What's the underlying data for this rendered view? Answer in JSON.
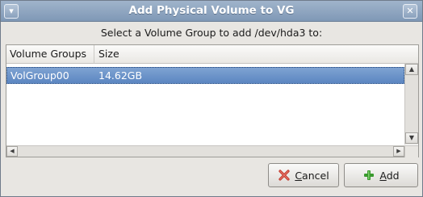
{
  "window": {
    "title": "Add Physical Volume to VG"
  },
  "prompt": "Select a Volume Group to add /dev/hda3 to:",
  "table": {
    "columns": [
      "Volume Groups",
      "Size"
    ],
    "rows": [
      {
        "volume_group": "VolGroup00",
        "size": "14.62GB",
        "selected": true
      }
    ]
  },
  "buttons": {
    "cancel": {
      "mnemonic": "C",
      "rest": "ancel",
      "icon": "cancel-x-icon"
    },
    "add": {
      "mnemonic": "A",
      "rest": "dd",
      "icon": "plus-icon"
    }
  },
  "colors": {
    "titlebar": "#8aa1bd",
    "selection": "#6a93c9",
    "cancel_icon": "#c0392b",
    "add_icon": "#3a9a2e"
  }
}
